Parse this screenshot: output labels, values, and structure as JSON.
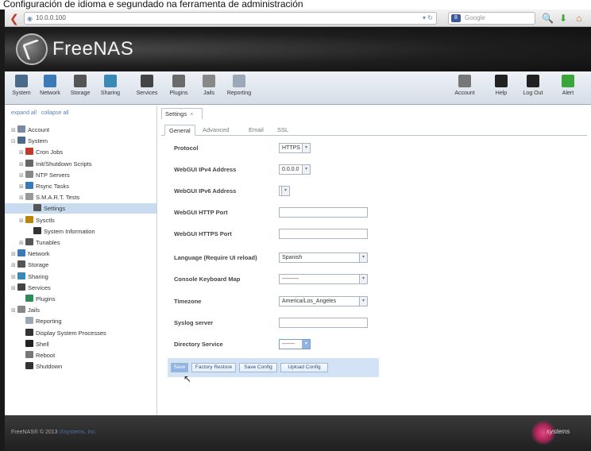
{
  "caption": "Configuración de idioma e segundado na ferramenta de administración",
  "browser": {
    "url": "10.0.0.100",
    "search_placeholder": "Google"
  },
  "app": {
    "title": "FreeNAS"
  },
  "toolbar": {
    "left": [
      {
        "label": "System",
        "icon": "system-icon",
        "color": "#4a6a8a"
      },
      {
        "label": "Network",
        "icon": "network-icon",
        "color": "#3a7ab8"
      },
      {
        "label": "Storage",
        "icon": "storage-icon",
        "color": "#555555"
      },
      {
        "label": "Sharing",
        "icon": "sharing-icon",
        "color": "#3a8ab8"
      },
      {
        "label": "Services",
        "icon": "services-icon",
        "color": "#444444"
      },
      {
        "label": "Plugins",
        "icon": "plugins-icon",
        "color": "#6a6a6a"
      },
      {
        "label": "Jails",
        "icon": "jails-icon",
        "color": "#888888"
      },
      {
        "label": "Reporting",
        "icon": "reporting-icon",
        "color": "#9aa8b8"
      }
    ],
    "right": [
      {
        "label": "Account",
        "icon": "account-icon",
        "color": "#777777"
      },
      {
        "label": "Help",
        "icon": "help-icon",
        "color": "#222222"
      },
      {
        "label": "Log Out",
        "icon": "logout-icon",
        "color": "#222222"
      },
      {
        "label": "Alert",
        "icon": "alert-icon",
        "color": "#3aa63a"
      }
    ]
  },
  "sidebar": {
    "expand_all": "expand all",
    "collapse_all": "collapse all",
    "items": [
      {
        "label": "Account",
        "level": 0,
        "toggle": "⊞",
        "icon_color": "#7a8aa0"
      },
      {
        "label": "System",
        "level": 0,
        "toggle": "⊟",
        "icon_color": "#4a6a8a"
      },
      {
        "label": "Cron Jobs",
        "level": 1,
        "toggle": "⊞",
        "icon_color": "#c0392b"
      },
      {
        "label": "Init/Shutdown Scripts",
        "level": 1,
        "toggle": "⊞",
        "icon_color": "#666666"
      },
      {
        "label": "NTP Servers",
        "level": 1,
        "toggle": "⊞",
        "icon_color": "#888888"
      },
      {
        "label": "Rsync Tasks",
        "level": 1,
        "toggle": "⊞",
        "icon_color": "#3a7ab8"
      },
      {
        "label": "S.M.A.R.T. Tests",
        "level": 1,
        "toggle": "⊞",
        "icon_color": "#999999"
      },
      {
        "label": "Settings",
        "level": 2,
        "toggle": "",
        "icon_color": "#555555",
        "selected": true
      },
      {
        "label": "Sysctls",
        "level": 1,
        "toggle": "⊞",
        "icon_color": "#b8860b"
      },
      {
        "label": "System Information",
        "level": 2,
        "toggle": "",
        "icon_color": "#333333"
      },
      {
        "label": "Tunables",
        "level": 1,
        "toggle": "⊞",
        "icon_color": "#555555"
      },
      {
        "label": "Network",
        "level": 0,
        "toggle": "⊞",
        "icon_color": "#3a7ab8"
      },
      {
        "label": "Storage",
        "level": 0,
        "toggle": "⊞",
        "icon_color": "#555555"
      },
      {
        "label": "Sharing",
        "level": 0,
        "toggle": "⊞",
        "icon_color": "#3a8ab8"
      },
      {
        "label": "Services",
        "level": 0,
        "toggle": "⊞",
        "icon_color": "#444444"
      },
      {
        "label": "Plugins",
        "level": 1,
        "toggle": "",
        "icon_color": "#2e8b57"
      },
      {
        "label": "Jails",
        "level": 0,
        "toggle": "⊞",
        "icon_color": "#888888"
      },
      {
        "label": "Reporting",
        "level": 1,
        "toggle": "",
        "icon_color": "#9aa8b8"
      },
      {
        "label": "Display System Processes",
        "level": 1,
        "toggle": "",
        "icon_color": "#333333"
      },
      {
        "label": "Shell",
        "level": 1,
        "toggle": "",
        "icon_color": "#222222"
      },
      {
        "label": "Reboot",
        "level": 1,
        "toggle": "",
        "icon_color": "#777777"
      },
      {
        "label": "Shutdown",
        "level": 1,
        "toggle": "",
        "icon_color": "#333333"
      }
    ]
  },
  "content": {
    "tab": "Settings",
    "subtabs": [
      "General",
      "Advanced",
      "Email",
      "SSL"
    ],
    "form": [
      {
        "label": "Protocol",
        "value": "HTTPS",
        "type": "select"
      },
      {
        "label": "WebGUI IPv4 Address",
        "value": "0.0.0.0",
        "type": "select"
      },
      {
        "label": "WebGUI IPv6 Address",
        "value": "-",
        "type": "select"
      },
      {
        "label": "WebGUI HTTP Port",
        "value": "",
        "type": "text"
      },
      {
        "label": "WebGUI HTTPS Port",
        "value": "",
        "type": "text"
      },
      {
        "label": "Language (Require UI reload)",
        "value": "Spanish",
        "type": "select"
      },
      {
        "label": "Console Keyboard Map",
        "value": "---------",
        "type": "select"
      },
      {
        "label": "Timezone",
        "value": "America/Los_Angeles",
        "type": "select"
      },
      {
        "label": "Syslog server",
        "value": "",
        "type": "text"
      },
      {
        "label": "Directory Service",
        "value": "-------",
        "type": "select"
      }
    ],
    "buttons": [
      "Save",
      "Factory Restore",
      "Save Config",
      "Upload Config"
    ]
  },
  "footer": {
    "copyright": "FreeNAS® © 2013",
    "company": "iXsystems, Inc.",
    "logo_text": "systems"
  }
}
